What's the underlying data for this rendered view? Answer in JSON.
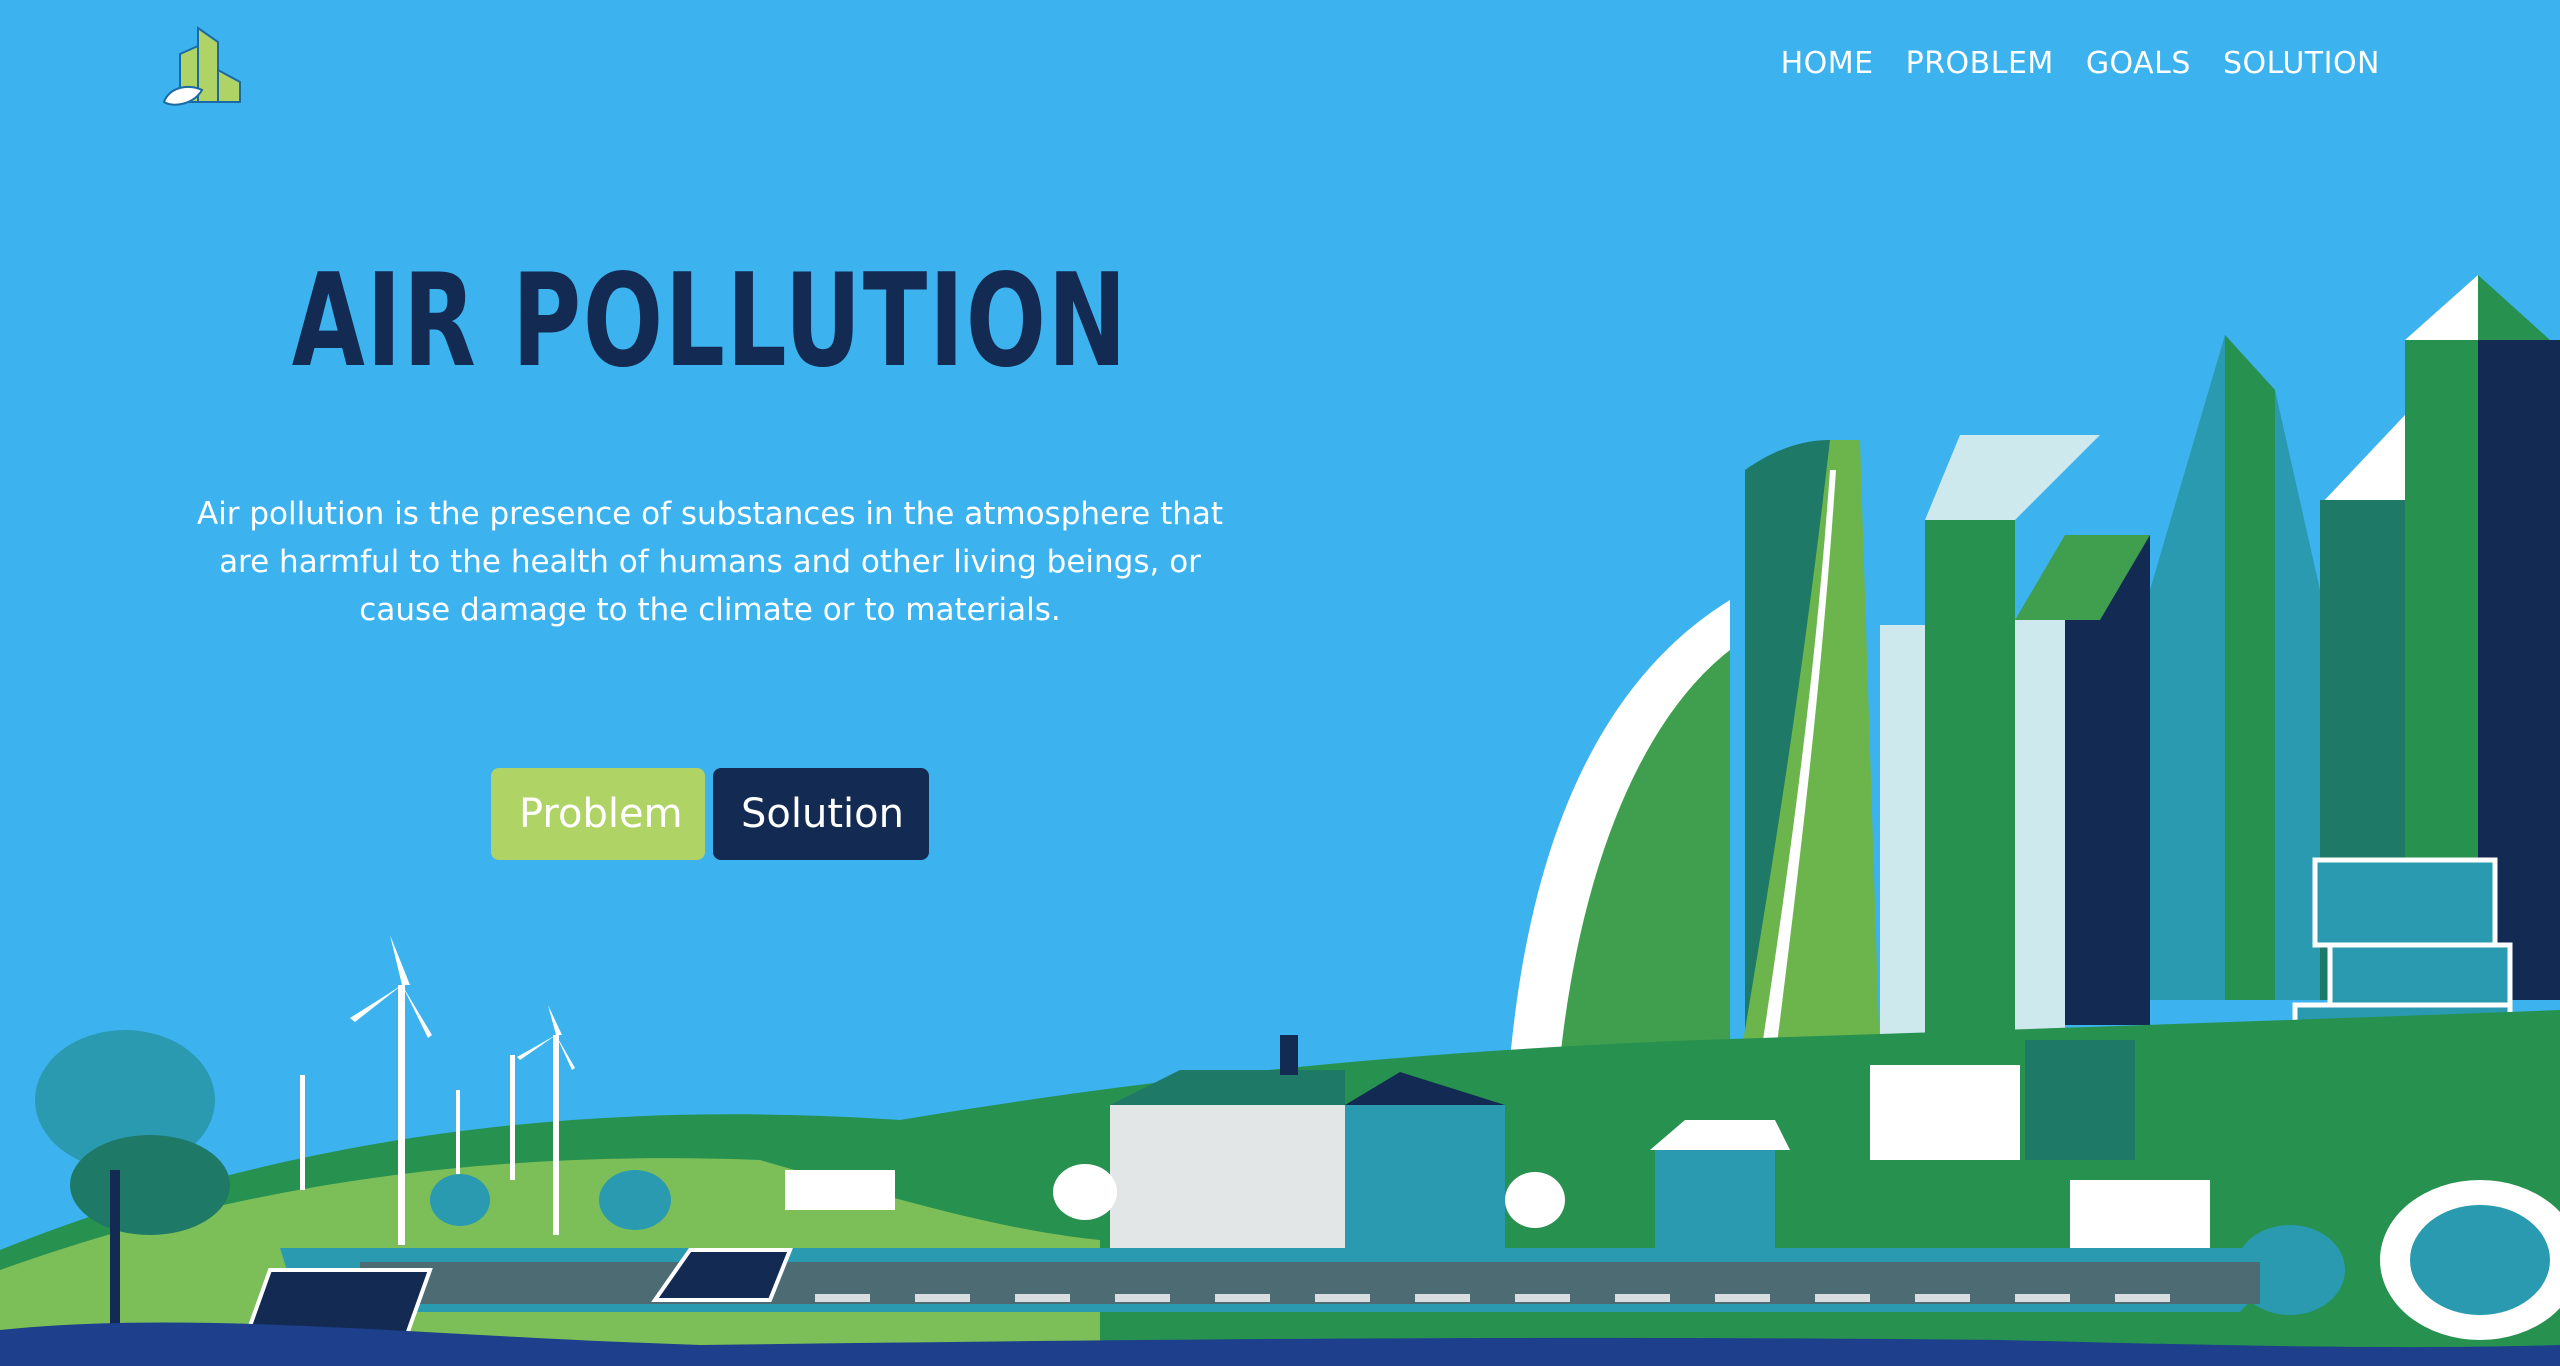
{
  "header": {
    "logo_icon": "eco-building-leaf-icon",
    "nav": [
      {
        "label": "HOME"
      },
      {
        "label": "PROBLEM"
      },
      {
        "label": "GOALS"
      },
      {
        "label": "SOLUTION"
      }
    ]
  },
  "hero": {
    "title": "AIR POLLUTION",
    "description": "Air pollution is the presence of substances in the atmosphere that are harmful to the health of humans and other living beings, or cause damage to the climate or to materials.",
    "buttons": {
      "problem": "Problem",
      "solution": "Solution"
    }
  },
  "colors": {
    "sky": "#3cb3ee",
    "navy": "#132a52",
    "lime": "#b0d366",
    "green": "#27914f",
    "teal": "#2a9ab0"
  },
  "illustration": {
    "icons": [
      "city-skyline",
      "wind-turbine-icon",
      "solar-panel-icon",
      "tree-icon",
      "house-icon",
      "road-icon"
    ]
  }
}
